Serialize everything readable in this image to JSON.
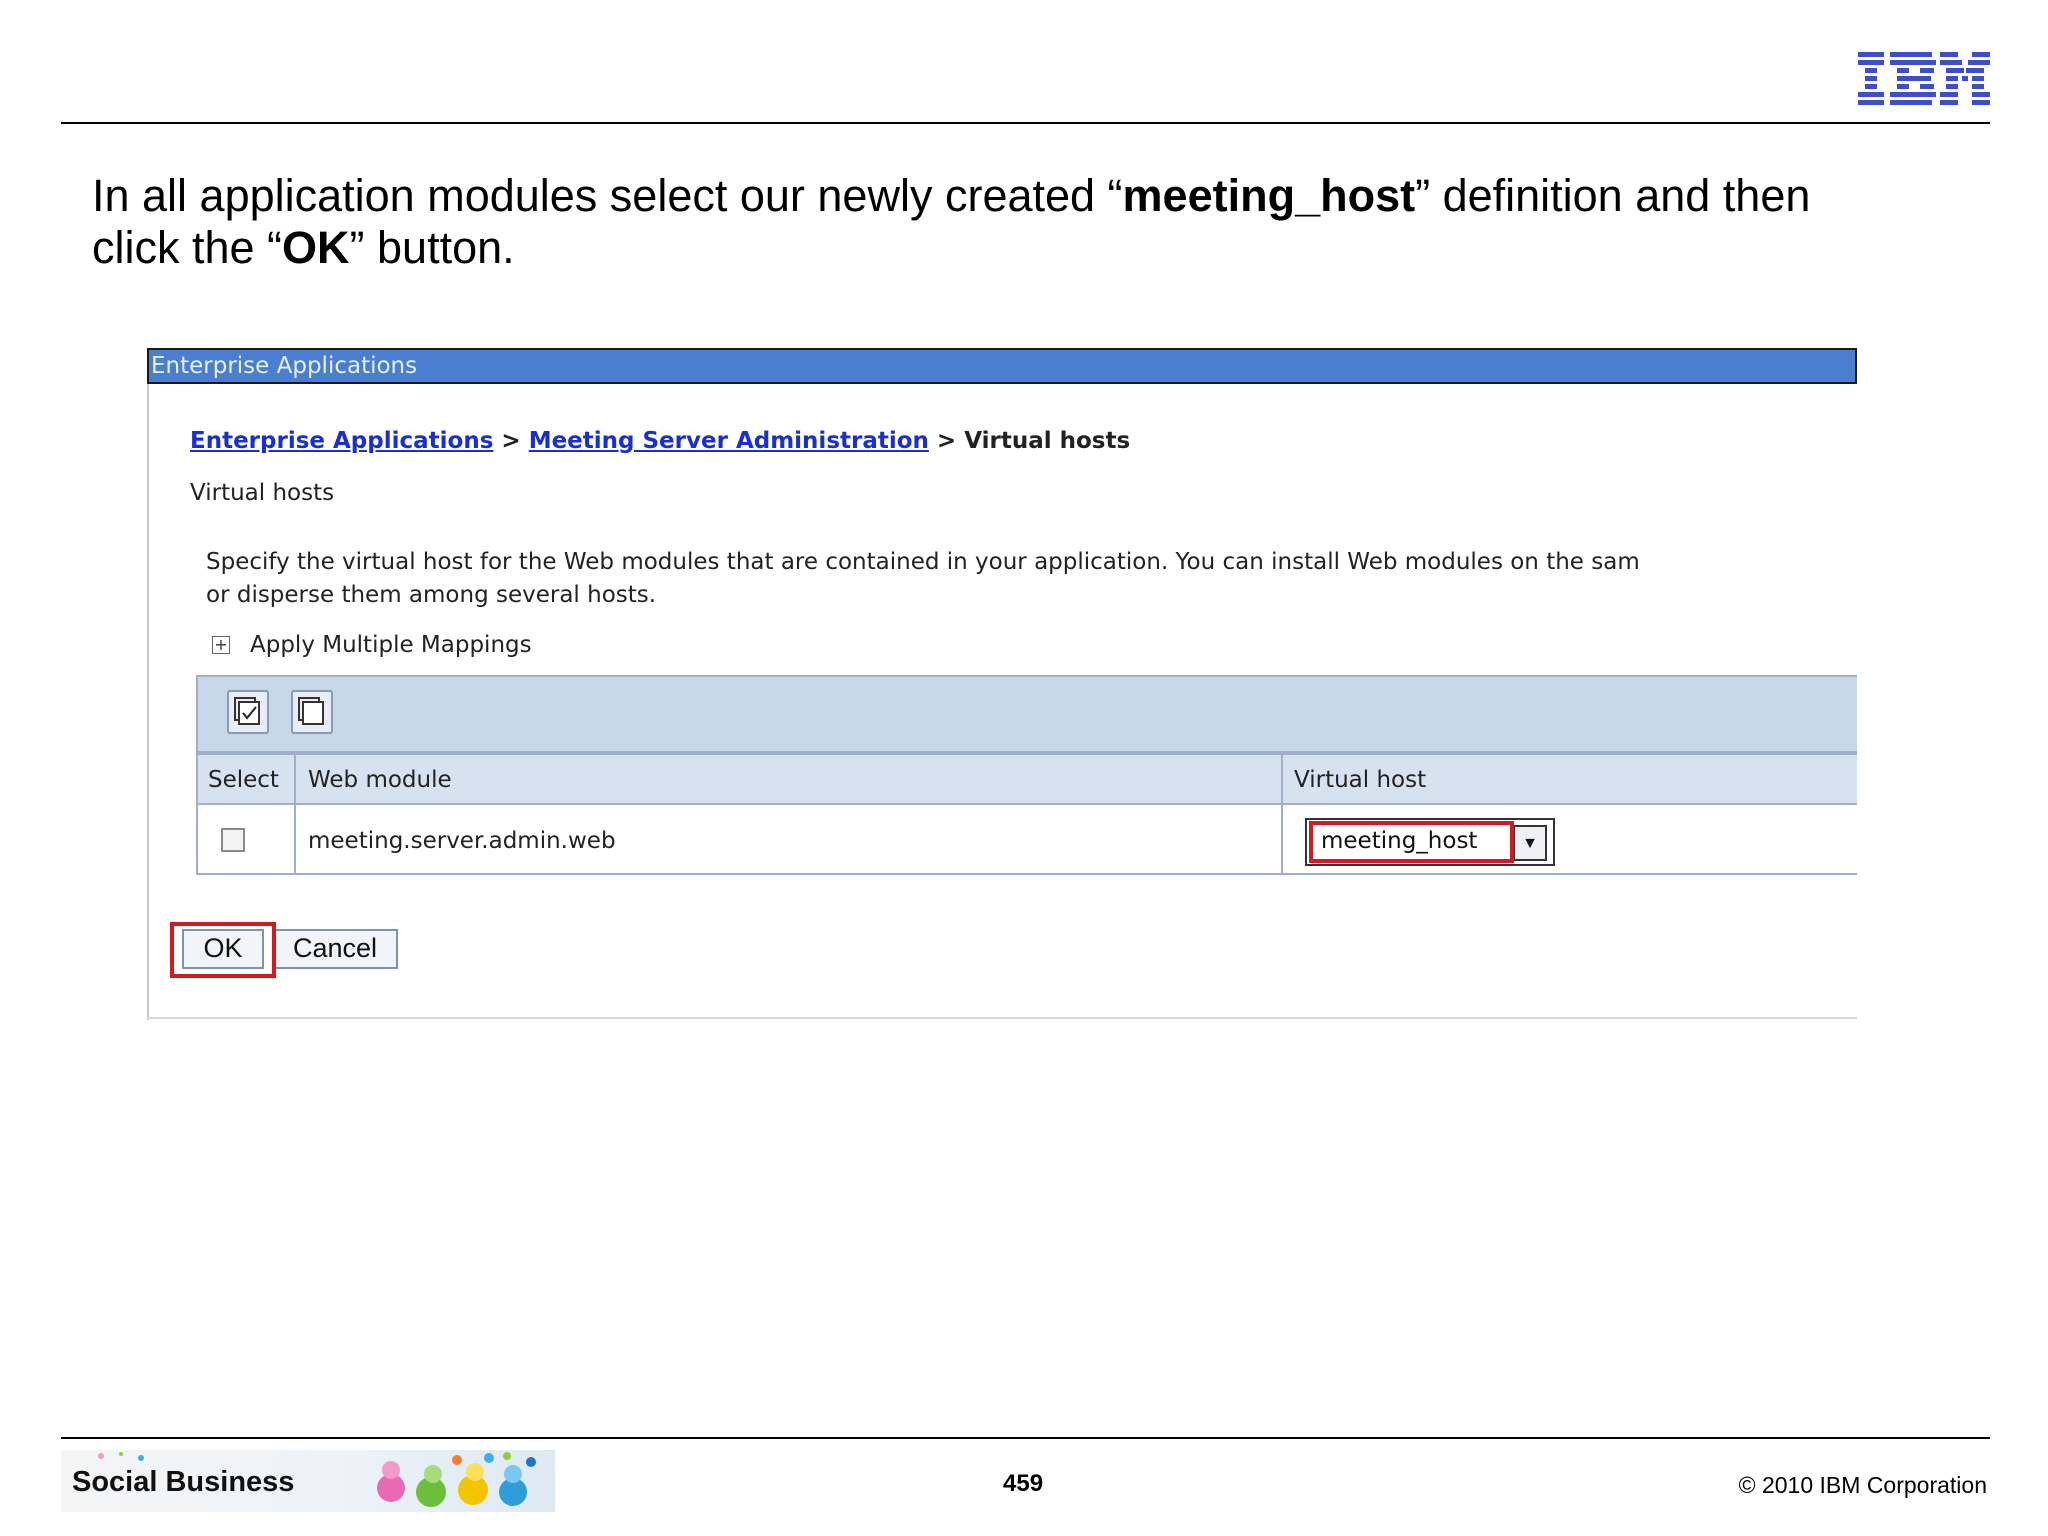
{
  "logo": {
    "text": "IBM",
    "color": "#3a4fc8"
  },
  "instruction": {
    "part1": "In all application modules select our newly created “",
    "bold1": "meeting_host",
    "part2": "” definition and then",
    "part3": "click the “",
    "bold2": "OK",
    "part4": "” button."
  },
  "window": {
    "title": "Enterprise Applications",
    "title_bar_color": "#4a7fd0"
  },
  "breadcrumb": {
    "link1": "Enterprise Applications",
    "link2": "Meeting Server Administration",
    "current": "Virtual hosts",
    "separator": ">"
  },
  "page_subtitle": "Virtual hosts",
  "description": {
    "line1": "Specify the virtual host for the Web modules that are contained in your application. You can install Web modules on the sam",
    "line2": "or disperse them among several hosts."
  },
  "apply_multiple_mappings": {
    "expander": "+",
    "label": "Apply Multiple Mappings"
  },
  "table": {
    "toolbar_buttons": [
      "select-all-icon",
      "deselect-all-icon"
    ],
    "headers": [
      "Select",
      "Web module",
      "Virtual host"
    ],
    "rows": [
      {
        "selected": false,
        "web_module": "meeting.server.admin.web",
        "virtual_host": "meeting_host"
      }
    ]
  },
  "buttons": {
    "ok": "OK",
    "cancel": "Cancel"
  },
  "highlight_color": "#d21a23",
  "footer": {
    "brand": "Social Business",
    "page_number": "459",
    "copyright": "© 2010 IBM Corporation"
  }
}
